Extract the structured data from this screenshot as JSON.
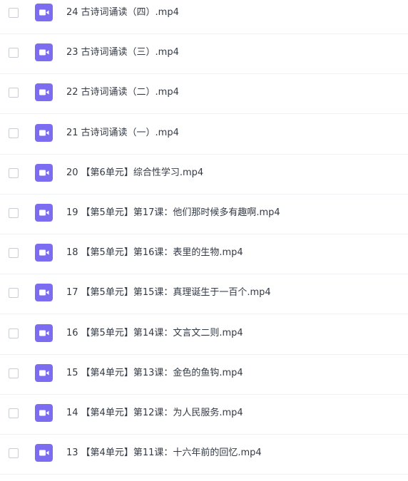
{
  "files": [
    {
      "num": "24",
      "title": "古诗词诵读（四）.mp4"
    },
    {
      "num": "23",
      "title": "古诗词诵读（三）.mp4"
    },
    {
      "num": "22",
      "title": "古诗词诵读（二）.mp4"
    },
    {
      "num": "21",
      "title": "古诗词诵读（一）.mp4"
    },
    {
      "num": "20",
      "title": "【第6单元】综合性学习.mp4"
    },
    {
      "num": "19",
      "title": "【第5单元】第17课：他们那时候多有趣啊.mp4"
    },
    {
      "num": "18",
      "title": "【第5单元】第16课：表里的生物.mp4"
    },
    {
      "num": "17",
      "title": "【第5单元】第15课：真理诞生于一百个.mp4"
    },
    {
      "num": "16",
      "title": "【第5单元】第14课：文言文二则.mp4"
    },
    {
      "num": "15",
      "title": "【第4单元】第13课：金色的鱼钩.mp4"
    },
    {
      "num": "14",
      "title": "【第4单元】第12课：为人民服务.mp4"
    },
    {
      "num": "13",
      "title": "【第4单元】第11课：十六年前的回忆.mp4"
    }
  ],
  "icon": {
    "name": "video-file-icon",
    "color": "#7b6cf0"
  }
}
